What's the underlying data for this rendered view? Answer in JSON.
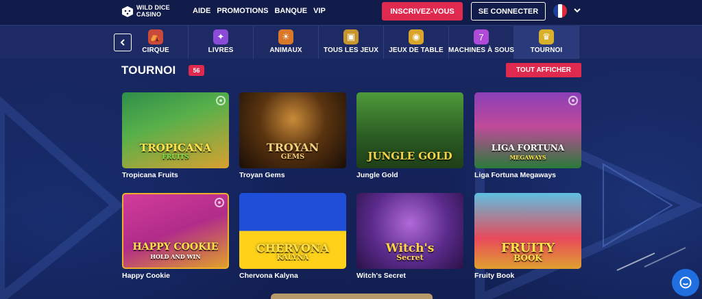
{
  "brand": {
    "name_line1": "WILD DICE",
    "name_line2": "CASINO",
    "logo_icon": "dice-icon"
  },
  "topnav": [
    "AIDE",
    "PROMOTIONS",
    "BANQUE",
    "VIP"
  ],
  "auth": {
    "register_label": "INSCRIVEZ-VOUS",
    "login_label": "SE CONNECTER"
  },
  "language": {
    "flag": "france-flag-icon"
  },
  "categories": [
    {
      "label": "CIRQUE",
      "icon": "circus-tent-icon",
      "color": "#c94a3a"
    },
    {
      "label": "LIVRES",
      "icon": "book-icon",
      "color": "#8c4ad8"
    },
    {
      "label": "ANIMAUX",
      "icon": "lion-icon",
      "color": "#d9782a"
    },
    {
      "label": "TOUS LES JEUX",
      "icon": "treasure-chest-icon",
      "color": "#c8962a"
    },
    {
      "label": "JEUX DE TABLE",
      "icon": "chip-icon",
      "color": "#d9a52a"
    },
    {
      "label": "MACHINES À SOUS",
      "icon": "slot-machine-icon",
      "color": "#b04ad8"
    },
    {
      "label": "TOURNOI",
      "icon": "trophy-icon",
      "color": "#d9b02a"
    }
  ],
  "active_category": "TOURNOI",
  "section": {
    "title": "TOURNOI",
    "count": "56",
    "show_all_label": "TOUT AFFICHER"
  },
  "games": [
    {
      "name": "Tropicana Fruits",
      "art_title": "TROPICANA",
      "art_sub": "FRUITS",
      "favorite_icon": true
    },
    {
      "name": "Troyan Gems",
      "art_title": "TROYAN",
      "art_sub": "GEMS",
      "favorite_icon": false
    },
    {
      "name": "Jungle Gold",
      "art_title": "JUNGLE GOLD",
      "art_sub": "",
      "favorite_icon": false
    },
    {
      "name": "Liga Fortuna Megaways",
      "art_title": "LIGA FORTUNA",
      "art_sub": "MEGAWAYS",
      "favorite_icon": true
    },
    {
      "name": "Happy Cookie",
      "art_title": "HAPPY COOKIE",
      "art_sub": "HOLD AND WIN",
      "favorite_icon": true
    },
    {
      "name": "Chervona Kalyna",
      "art_title": "CHERVONA",
      "art_sub": "KALYNA",
      "favorite_icon": false
    },
    {
      "name": "Witch's Secret",
      "art_title": "Witch's",
      "art_sub": "Secret",
      "favorite_icon": false
    },
    {
      "name": "Fruity Book",
      "art_title": "FRUITY",
      "art_sub": "BOOK",
      "favorite_icon": false
    }
  ]
}
